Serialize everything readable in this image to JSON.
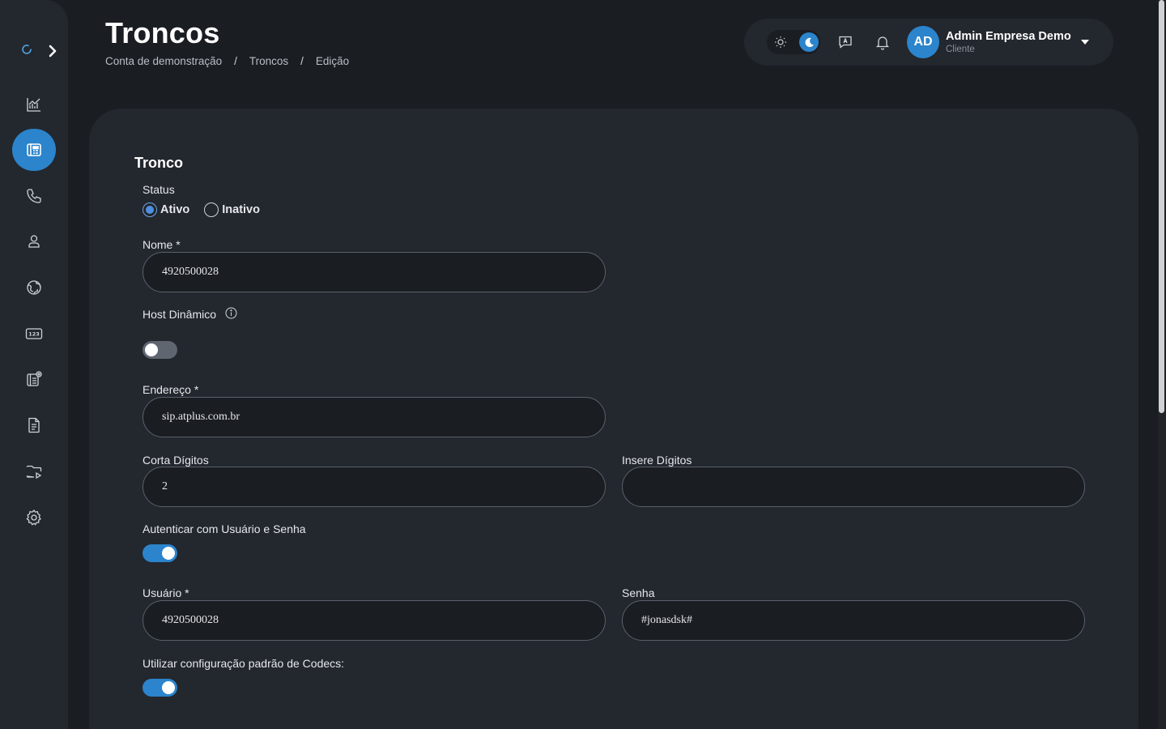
{
  "header": {
    "title": "Troncos",
    "breadcrumb": [
      "Conta de demonstração",
      "Troncos",
      "Edição"
    ],
    "breadcrumb_separator": "/"
  },
  "topbar": {
    "user_initials": "AD",
    "user_name": "Admin Empresa Demo",
    "user_role": "Cliente",
    "theme": "dark"
  },
  "sidebar": {
    "items": [
      {
        "icon": "chart-icon",
        "active": false
      },
      {
        "icon": "trunk-icon",
        "active": true
      },
      {
        "icon": "phone-icon",
        "active": false
      },
      {
        "icon": "user-icon",
        "active": false
      },
      {
        "icon": "globe-icon",
        "active": false
      },
      {
        "icon": "numbers-icon",
        "active": false
      },
      {
        "icon": "trunk-settings-icon",
        "active": false
      },
      {
        "icon": "document-icon",
        "active": false
      },
      {
        "icon": "folder-play-icon",
        "active": false
      },
      {
        "icon": "gear-icon",
        "active": false
      }
    ]
  },
  "form": {
    "section_title": "Tronco",
    "status": {
      "label": "Status",
      "options": [
        "Ativo",
        "Inativo"
      ],
      "selected": "Ativo"
    },
    "nome": {
      "label": "Nome *",
      "value": "4920500028"
    },
    "host_dinamico": {
      "label": "Host Dinâmico",
      "enabled": false
    },
    "endereco": {
      "label": "Endereço *",
      "value": "sip.atplus.com.br"
    },
    "corta_digitos": {
      "label": "Corta Dígitos",
      "value": "2"
    },
    "insere_digitos": {
      "label": "Insere Dígitos",
      "value": ""
    },
    "autenticar": {
      "label": "Autenticar com Usuário e Senha",
      "enabled": true
    },
    "usuario": {
      "label": "Usuário *",
      "value": "4920500028"
    },
    "senha": {
      "label": "Senha",
      "value": "#jonasdsk#"
    },
    "codecs": {
      "label": "Utilizar configuração padrão de Codecs:",
      "enabled": true
    }
  },
  "colors": {
    "background": "#1a1d22",
    "surface": "#23272e",
    "accent": "#2b84cc",
    "input_border": "#5a616b"
  }
}
